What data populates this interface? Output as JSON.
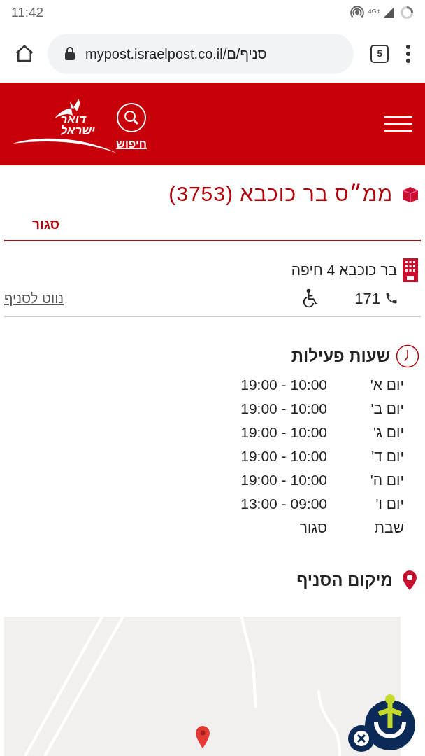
{
  "status_bar": {
    "time": "11:42",
    "network": "4G+"
  },
  "browser": {
    "url": "mypost.israelpost.co.il/סניף/ם",
    "tab_count": "5"
  },
  "header": {
    "logo_text": [
      "דואר",
      "ישראל"
    ],
    "search_label": "חיפוש"
  },
  "branch": {
    "title": "ממ״ס בר כוכבא (3753)",
    "status": "סגור",
    "address": "בר כוכבא 4 חיפה",
    "phone": "171",
    "accessible": true,
    "navigate_link": "נווט לסניף"
  },
  "hours": {
    "title": "שעות פעילות",
    "rows": [
      {
        "day": "יום א'",
        "hours": "19:00 - 10:00"
      },
      {
        "day": "יום ב'",
        "hours": "19:00 - 10:00"
      },
      {
        "day": "יום ג'",
        "hours": "19:00 - 10:00"
      },
      {
        "day": "יום ד'",
        "hours": "19:00 - 10:00"
      },
      {
        "day": "יום ה'",
        "hours": "19:00 - 10:00"
      },
      {
        "day": "יום ו'",
        "hours": "13:00 - 09:00"
      },
      {
        "day": "שבת",
        "hours": "סגור"
      }
    ]
  },
  "location": {
    "title": "מיקום הסניף"
  }
}
